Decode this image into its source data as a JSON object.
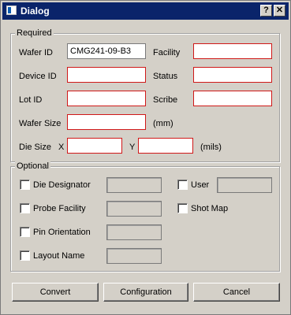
{
  "window": {
    "title": "Dialog",
    "help_glyph": "?",
    "close_glyph": "✕"
  },
  "required": {
    "legend": "Required",
    "wafer_id": {
      "label": "Wafer ID",
      "value": "CMG241-09-B3"
    },
    "facility": {
      "label": "Facility",
      "value": ""
    },
    "device_id": {
      "label": "Device ID",
      "value": ""
    },
    "status": {
      "label": "Status",
      "value": ""
    },
    "lot_id": {
      "label": "Lot ID",
      "value": ""
    },
    "scribe": {
      "label": "Scribe",
      "value": ""
    },
    "wafer_size": {
      "label": "Wafer Size",
      "value": "",
      "unit": "(mm)"
    },
    "die_size": {
      "label": "Die Size",
      "x_label": "X",
      "x_value": "",
      "y_label": "Y",
      "y_value": "",
      "unit": "(mils)"
    }
  },
  "optional": {
    "legend": "Optional",
    "die_designator": {
      "label": "Die Designator",
      "checked": false
    },
    "probe_facility": {
      "label": "Probe Facility",
      "checked": false
    },
    "pin_orientation": {
      "label": "Pin Orientation",
      "checked": false
    },
    "layout_name": {
      "label": "Layout Name",
      "checked": false
    },
    "user": {
      "label": "User",
      "checked": false
    },
    "shot_map": {
      "label": "Shot Map",
      "checked": false
    }
  },
  "buttons": {
    "convert": "Convert",
    "configuration": "Configuration",
    "cancel": "Cancel"
  },
  "colors": {
    "titlebar": "#0a246a",
    "required_border": "#d01818",
    "face": "#d4d0c8"
  }
}
